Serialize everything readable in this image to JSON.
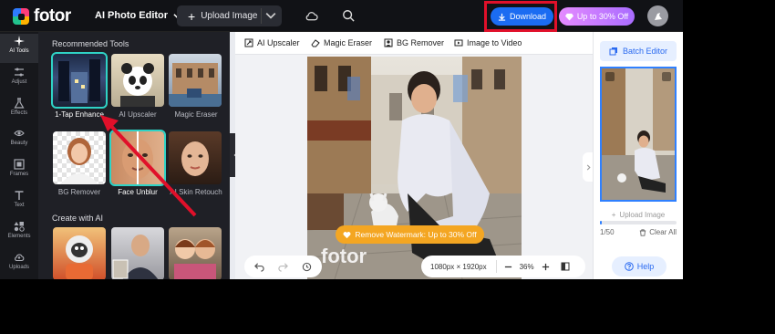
{
  "topbar": {
    "logo_text": "fotor",
    "editor_menu": "AI Photo Editor",
    "upload_label": "Upload Image",
    "download_label": "Download",
    "promo_label": "Up to 30% Off",
    "accent_color": "#1b6cf2",
    "highlight_color": "#e0102a"
  },
  "rail": {
    "items": [
      {
        "label": "AI Tools",
        "icon": "sparkle-icon"
      },
      {
        "label": "Adjust",
        "icon": "sliders-icon"
      },
      {
        "label": "Effects",
        "icon": "flask-icon"
      },
      {
        "label": "Beauty",
        "icon": "eye-icon"
      },
      {
        "label": "Frames",
        "icon": "frame-icon"
      },
      {
        "label": "Text",
        "icon": "text-icon"
      },
      {
        "label": "Elements",
        "icon": "shapes-icon"
      },
      {
        "label": "Uploads",
        "icon": "cloud-upload-icon"
      }
    ]
  },
  "panel": {
    "recommended_title": "Recommended Tools",
    "tools": [
      {
        "label": "1-Tap Enhance"
      },
      {
        "label": "AI Upscaler"
      },
      {
        "label": "Magic Eraser"
      },
      {
        "label": "BG Remover"
      },
      {
        "label": "Face Unblur"
      },
      {
        "label": "AI Skin Retouch"
      }
    ],
    "create_title": "Create with AI"
  },
  "main": {
    "tabs": [
      {
        "label": "AI Upscaler",
        "icon": "upscale-icon"
      },
      {
        "label": "Magic Eraser",
        "icon": "eraser-icon"
      },
      {
        "label": "BG Remover",
        "icon": "bg-remove-icon"
      },
      {
        "label": "Image to Video",
        "icon": "video-icon"
      }
    ],
    "watermark_banner": "Remove Watermark: Up to 30% Off",
    "watermark_text": "fotor",
    "dimensions": "1080px × 1920px",
    "zoom": "36%"
  },
  "right": {
    "batch_label": "Batch Editor",
    "upload_label": "Upload Image",
    "count": "1/50",
    "clear_label": "Clear All",
    "help_label": "Help"
  }
}
